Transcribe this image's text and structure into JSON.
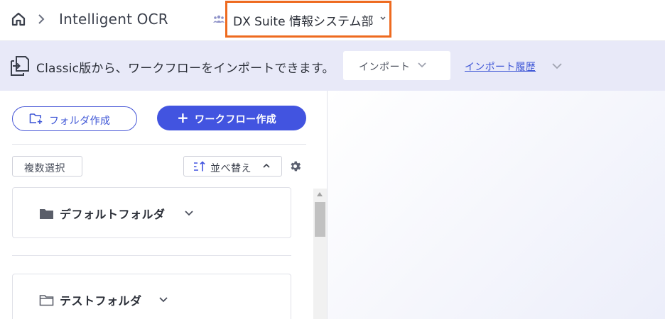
{
  "header": {
    "home_icon": "home-icon",
    "breadcrumb_separator_icon": "chevron-right-icon",
    "app_title": "Intelligent OCR",
    "group_icon": "group-icon",
    "department": "DX Suite 情報システム部",
    "department_chevron_icon": "chevron-down-icon",
    "highlight_color": "#ee6a1f"
  },
  "banner": {
    "icon": "import-icon",
    "message": "Classic版から、ワークフローをインポートできます。",
    "import_dropdown": "インポート",
    "history_link": "インポート履歴",
    "background": "#e8e9f8"
  },
  "toolbar": {
    "folder_create": "フォルダ作成",
    "workflow_create_plus": "+",
    "workflow_create": "ワークフロー作成",
    "multi_select": "複数選択",
    "sort": "並べ替え",
    "accent": "#4254e0"
  },
  "folders": [
    {
      "name": "デフォルトフォルダ",
      "icon": "folder-filled-icon"
    },
    {
      "name": "テストフォルダ",
      "icon": "folder-outline-icon"
    }
  ]
}
